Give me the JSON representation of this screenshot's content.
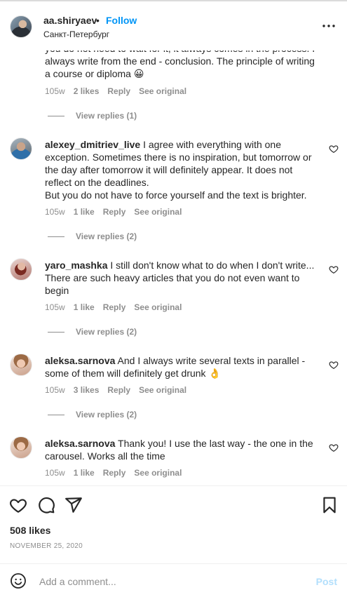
{
  "header": {
    "username": "aa.shiryaev",
    "separator": "•",
    "follow_label": "Follow",
    "location": "Санкт-Петербург",
    "more_icon": "more-horizontal-icon"
  },
  "comments": [
    {
      "partial": true,
      "text_tail": "you do not need to wait for it, it always comes in the process. I always write from the end - conclusion. The principle of writing a course or diploma 😀",
      "time": "105w",
      "likes": "2 likes",
      "reply_label": "Reply",
      "see_original_label": "See original",
      "view_replies": "View replies (1)"
    },
    {
      "username": "alexey_dmitriev_live",
      "text": "I agree with everything with one exception. Sometimes there is no inspiration, but tomorrow or the day after tomorrow it will definitely appear. It does not reflect on the deadlines.\nBut you do not have to force yourself and the text is brighter.",
      "time": "105w",
      "likes": "1 like",
      "reply_label": "Reply",
      "see_original_label": "See original",
      "view_replies": "View replies (2)"
    },
    {
      "username": "yaro_mashka",
      "text": "I still don't know what to do when I don't write... There are such heavy articles that you do not even want to begin",
      "time": "105w",
      "likes": "1 like",
      "reply_label": "Reply",
      "see_original_label": "See original",
      "view_replies": "View replies (2)"
    },
    {
      "username": "aleksa.sarnova",
      "text": "And I always write several texts in parallel - some of them will definitely get drunk 👌",
      "time": "105w",
      "likes": "3 likes",
      "reply_label": "Reply",
      "see_original_label": "See original",
      "view_replies": "View replies (2)"
    },
    {
      "username": "aleksa.sarnova",
      "text": "Thank you! I use the last way - the one in the carousel. Works all the time",
      "time": "105w",
      "likes": "1 like",
      "reply_label": "Reply",
      "see_original_label": "See original"
    }
  ],
  "actions": {
    "like_icon": "heart-icon",
    "comment_icon": "comment-icon",
    "share_icon": "share-icon",
    "save_icon": "bookmark-icon"
  },
  "likes_count": "508 likes",
  "date": "NOVEMBER 25, 2020",
  "add_comment": {
    "placeholder": "Add a comment...",
    "post_label": "Post",
    "post_color": "#b2dffc"
  },
  "colors": {
    "accent": "#0095f6",
    "muted": "#8e8e8e",
    "text": "#262626"
  }
}
